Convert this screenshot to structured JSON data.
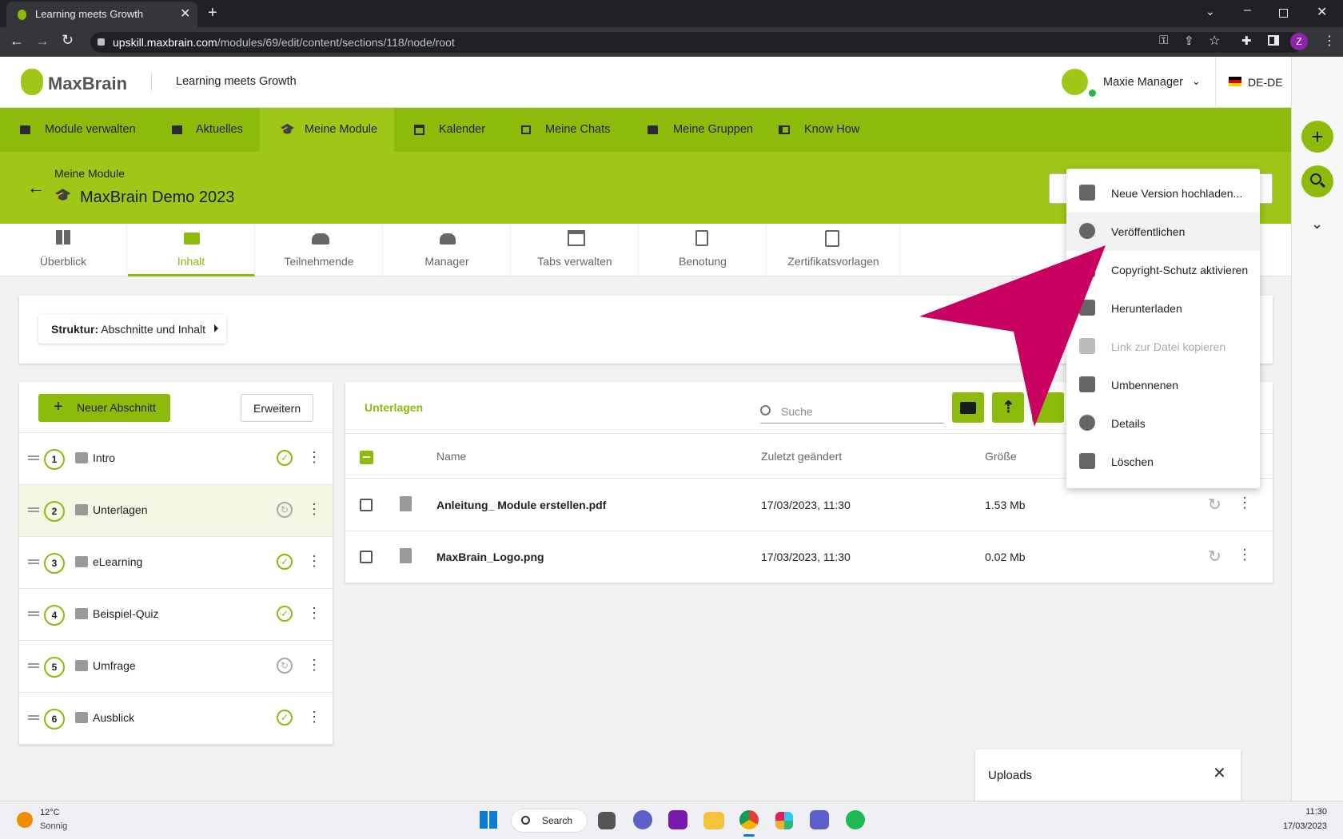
{
  "browser": {
    "tab_title": "Learning meets Growth",
    "url_host": "upskill.maxbrain.com",
    "url_path": "/modules/69/edit/content/sections/118/node/root",
    "profile_initial": "Z"
  },
  "header": {
    "logo_text": "MaxBrain",
    "tagline": "Learning meets Growth",
    "user_name": "Maxie Manager",
    "locale": "DE-DE"
  },
  "nav": {
    "items": [
      {
        "label": "Module verwalten"
      },
      {
        "label": "Aktuelles"
      },
      {
        "label": "Meine Module"
      },
      {
        "label": "Kalender"
      },
      {
        "label": "Meine Chats"
      },
      {
        "label": "Meine Gruppen"
      },
      {
        "label": "Know How"
      }
    ]
  },
  "banner": {
    "breadcrumb": "Meine Module",
    "title": "MaxBrain Demo 2023"
  },
  "tabs": [
    {
      "label": "Überblick"
    },
    {
      "label": "Inhalt"
    },
    {
      "label": "Teilnehmende"
    },
    {
      "label": "Manager"
    },
    {
      "label": "Tabs verwalten"
    },
    {
      "label": "Benotung"
    },
    {
      "label": "Zertifikatsvorlagen"
    }
  ],
  "structure": {
    "label_bold": "Struktur:",
    "label_rest": "Abschnitte und Inhalt"
  },
  "sections_panel": {
    "new_button": "Neuer Abschnitt",
    "expand_button": "Erweitern",
    "items": [
      {
        "num": "1",
        "label": "Intro",
        "status": "published"
      },
      {
        "num": "2",
        "label": "Unterlagen",
        "status": "pending"
      },
      {
        "num": "3",
        "label": "eLearning",
        "status": "published"
      },
      {
        "num": "4",
        "label": "Beispiel-Quiz",
        "status": "published"
      },
      {
        "num": "5",
        "label": "Umfrage",
        "status": "pending"
      },
      {
        "num": "6",
        "label": "Ausblick",
        "status": "published"
      }
    ]
  },
  "files_panel": {
    "title": "Unterlagen",
    "search_placeholder": "Suche",
    "col_name": "Name",
    "col_modified": "Zuletzt geändert",
    "col_size": "Größe",
    "rows": [
      {
        "name": "Anleitung_ Module erstellen.pdf",
        "modified": "17/03/2023, 11:30",
        "size": "1.53 Mb"
      },
      {
        "name": "MaxBrain_Logo.png",
        "modified": "17/03/2023, 11:30",
        "size": "0.02 Mb"
      }
    ]
  },
  "context_menu": {
    "items": [
      {
        "label": "Neue Version hochladen...",
        "icon": "cloud-upload-icon"
      },
      {
        "label": "Veröffentlichen",
        "icon": "sync-icon"
      },
      {
        "label": "Copyright-Schutz aktivieren",
        "icon": "copyright-icon"
      },
      {
        "label": "Herunterladen",
        "icon": "download-icon"
      },
      {
        "label": "Link zur Datei kopieren",
        "icon": "link-icon",
        "disabled": true
      },
      {
        "label": "Umbennenen",
        "icon": "pencil-icon"
      },
      {
        "label": "Details",
        "icon": "info-icon"
      },
      {
        "label": "Löschen",
        "icon": "trash-icon"
      }
    ]
  },
  "uploads": {
    "label": "Uploads"
  },
  "taskbar": {
    "temp": "12°C",
    "weather": "Sonnig",
    "search": "Search",
    "time": "11:30",
    "date": "17/03/2023"
  },
  "colors": {
    "brand": "#8dbb0c",
    "arrow": "#c8005f"
  }
}
